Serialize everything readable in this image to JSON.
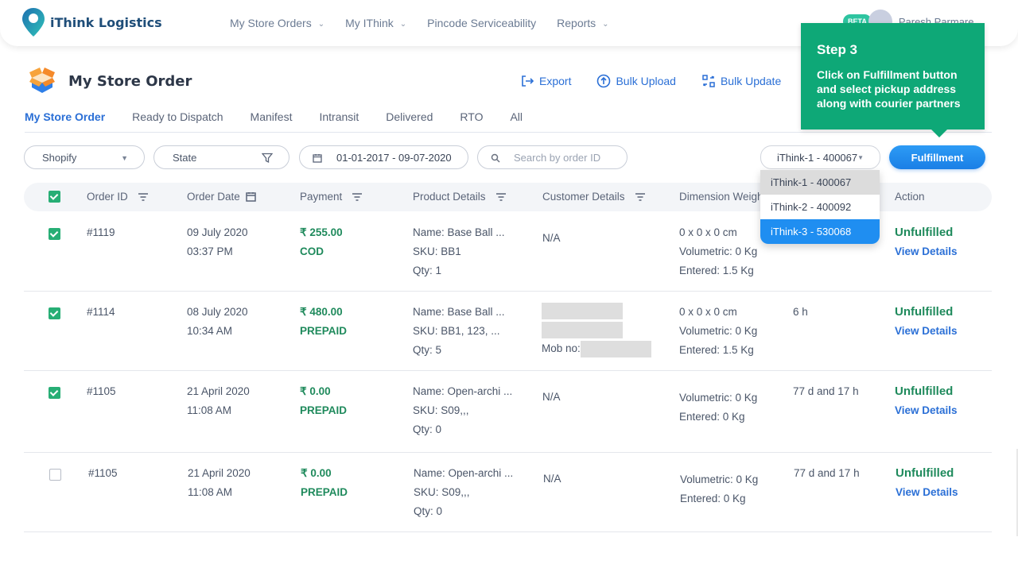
{
  "brand": {
    "name": "iThink Logistics",
    "logo_icon": "map-pin-logo-icon"
  },
  "nav": [
    {
      "label": "My Store Orders",
      "has_dropdown": true
    },
    {
      "label": "My IThink",
      "has_dropdown": true
    },
    {
      "label": "Pincode Serviceability",
      "has_dropdown": false
    },
    {
      "label": "Reports",
      "has_dropdown": true
    }
  ],
  "user": {
    "badge": "BETA",
    "name": "Paresh Parmare"
  },
  "page": {
    "title": "My Store Order",
    "icon": "open-box-icon"
  },
  "actions": [
    {
      "label": "Export",
      "icon": "export-icon"
    },
    {
      "label": "Bulk Upload",
      "icon": "upload-circle-icon"
    },
    {
      "label": "Bulk Update",
      "icon": "bulk-update-icon"
    }
  ],
  "tabs": [
    {
      "label": "My Store Order",
      "active": true
    },
    {
      "label": "Ready to Dispatch"
    },
    {
      "label": "Manifest"
    },
    {
      "label": "Intransit"
    },
    {
      "label": "Delivered"
    },
    {
      "label": "RTO"
    },
    {
      "label": "All"
    }
  ],
  "filters": {
    "store": "Shopify",
    "state": "State",
    "date_range": "01-01-2017 - 09-07-2020",
    "search_placeholder": "Search by order ID",
    "pickup_selected": "iThink-1 - 400067"
  },
  "pickup_options": [
    {
      "label": "iThink-1 - 400067",
      "state": "hover"
    },
    {
      "label": "iThink-2 - 400092",
      "state": "normal"
    },
    {
      "label": "iThink-3 - 530068",
      "state": "selected"
    }
  ],
  "fulfillment_button": "Fulfillment",
  "tooltip": {
    "title": "Step 3",
    "body": "Click on Fulfillment button and select pickup address along with courier partners"
  },
  "table": {
    "headers": [
      "Order ID",
      "Order Date",
      "Payment",
      "Product Details",
      "Customer Details",
      "Dimension Weight",
      "Action"
    ],
    "header_checkbox_checked": true,
    "rows": [
      {
        "checked": true,
        "order_id": "#1119",
        "date": "09 July 2020",
        "time": "03:37 PM",
        "amount": "₹ 255.00",
        "payment": "COD",
        "product_name": "Name: Base Ball ...",
        "sku": "SKU: BB1",
        "qty": "Qty: 1",
        "customer": "N/A",
        "dim": "0 x 0 x 0 cm",
        "vol": "Volumetric: 0 Kg",
        "entered": "Entered: 1.5 Kg",
        "age": "",
        "status": "Unfulfilled",
        "view": "View Details"
      },
      {
        "checked": true,
        "order_id": "#1114",
        "date": "08 July 2020",
        "time": "10:34 AM",
        "amount": "₹ 480.00",
        "payment": "PREPAID",
        "product_name": "Name: Base Ball ...",
        "sku": "SKU: BB1, 123, ...",
        "qty": "Qty: 5",
        "customer": "",
        "mob_label": "Mob no:",
        "dim": "0 x 0 x 0 cm",
        "vol": "Volumetric: 0 Kg",
        "entered": "Entered: 1.5 Kg",
        "age": "6 h",
        "status": "Unfulfilled",
        "view": "View Details"
      },
      {
        "checked": true,
        "order_id": "#1105",
        "date": "21 April 2020",
        "time": "11:08 AM",
        "amount": "₹ 0.00",
        "payment": "PREPAID",
        "product_name": "Name: Open-archi ...",
        "sku": "SKU: S09,,,",
        "qty": "Qty: 0",
        "customer": "N/A",
        "dim": "",
        "vol": "Volumetric: 0 Kg",
        "entered": "Entered: 0 Kg",
        "age": "77 d and 17 h",
        "status": "Unfulfilled",
        "view": "View Details"
      },
      {
        "checked": false,
        "order_id": "#1105",
        "date": "21 April 2020",
        "time": "11:08 AM",
        "amount": "₹ 0.00",
        "payment": "PREPAID",
        "product_name": "Name: Open-archi ...",
        "sku": "SKU: S09,,,",
        "qty": "Qty: 0",
        "customer": "N/A",
        "dim": "",
        "vol": "Volumetric: 0 Kg",
        "entered": "Entered: 0 Kg",
        "age": "77 d and 17 h",
        "status": "Unfulfilled",
        "view": "View Details"
      }
    ]
  },
  "colors": {
    "accent_blue": "#2a6fd6",
    "success_green": "#1f8a5c",
    "tooltip_green": "#0ea877",
    "checkbox_green": "#27ae75"
  }
}
